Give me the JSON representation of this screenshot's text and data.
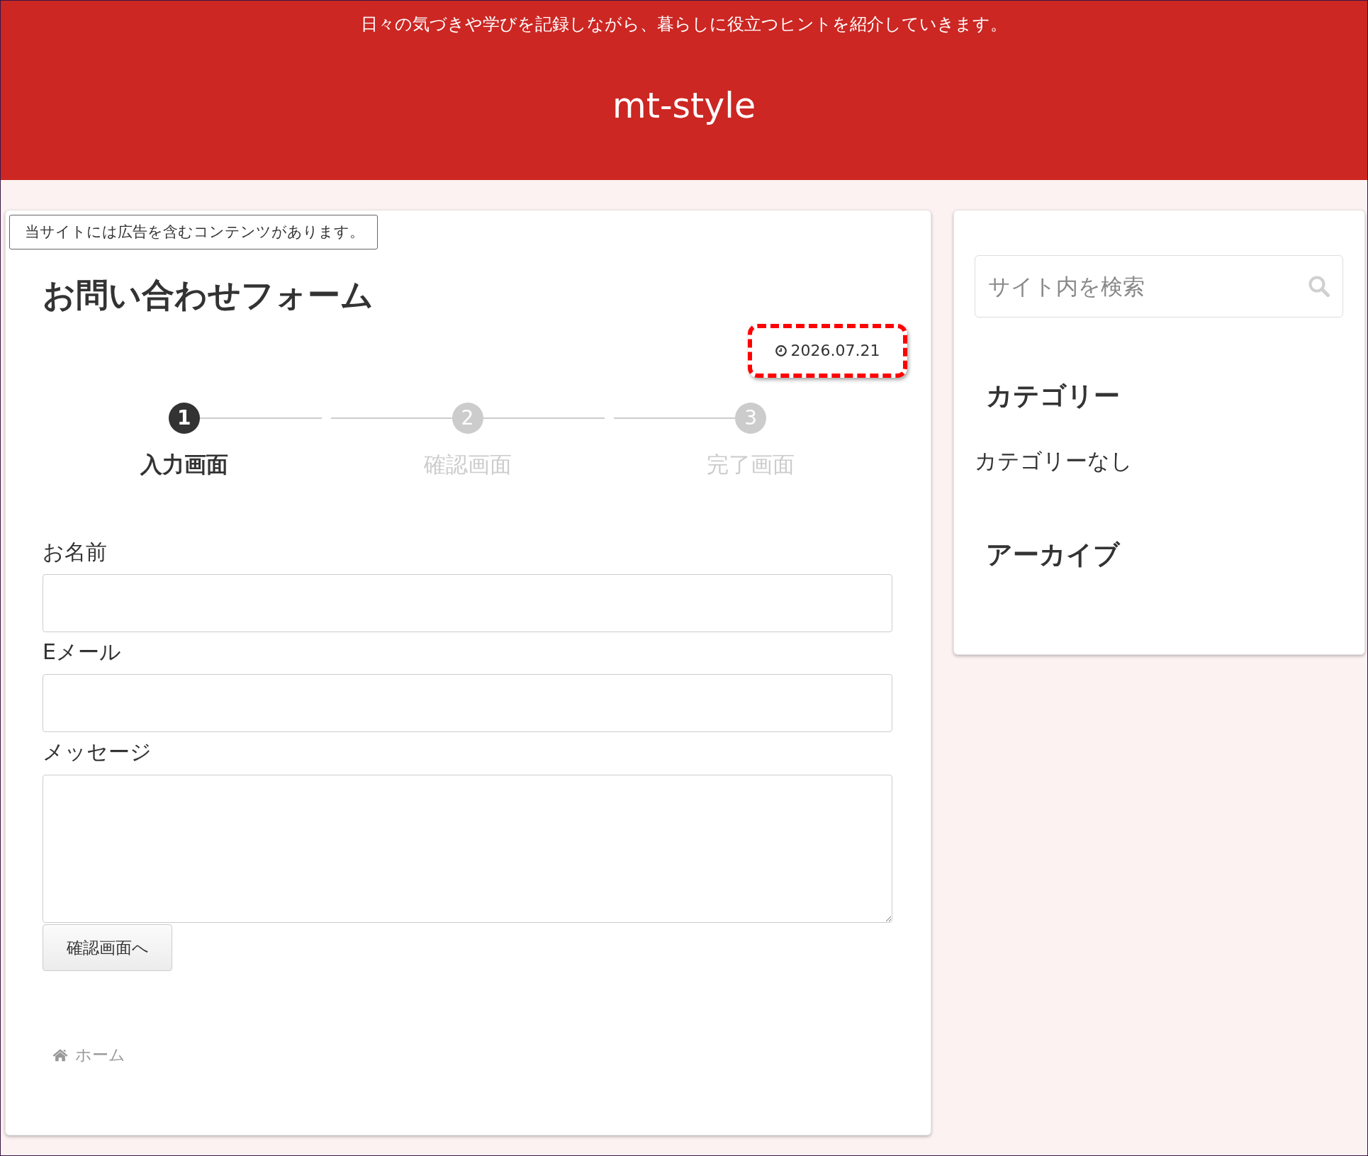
{
  "header": {
    "tagline": "日々の気づきや学びを記録しながら、暮らしに役立つヒントを紹介していきます。",
    "site_title": "mt-style"
  },
  "main": {
    "ad_notice": "当サイトには広告を含むコンテンツがあります。",
    "title": "お問い合わせフォーム",
    "date": {
      "text": "2026.07.21",
      "highlighted": true
    },
    "steps": [
      {
        "number": "1",
        "label": "入力画面",
        "selected": true
      },
      {
        "number": "2",
        "label": "確認画面",
        "selected": false
      },
      {
        "number": "3",
        "label": "完了画面",
        "selected": false
      }
    ],
    "form": {
      "fields": [
        {
          "kind": "text",
          "label": "お名前"
        },
        {
          "kind": "email",
          "label": "Eメール"
        },
        {
          "kind": "textarea",
          "label": "メッセージ"
        }
      ],
      "submit": "確認画面へ"
    },
    "breadcrumb": [
      {
        "label": "ホーム"
      }
    ]
  },
  "sidebar": {
    "search": {
      "placeholder": "サイト内を検索"
    },
    "widgets": [
      {
        "title": "カテゴリー",
        "text": "カテゴリーなし"
      },
      {
        "title": "アーカイブ"
      }
    ]
  }
}
